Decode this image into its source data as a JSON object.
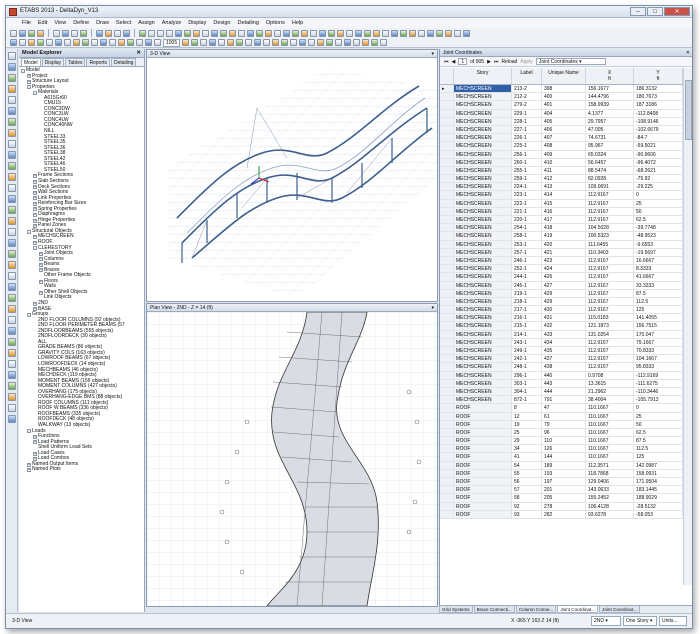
{
  "window": {
    "title": "ETABS 2013 - DeltaDyn_V13",
    "minimize": "–",
    "maximize": "□",
    "close": "✕"
  },
  "menu": [
    "File",
    "Edit",
    "View",
    "Define",
    "Draw",
    "Select",
    "Assign",
    "Analyze",
    "Display",
    "Design",
    "Detailing",
    "Options",
    "Help"
  ],
  "toolbar": {
    "zoom_value": "1005",
    "icons": [
      "new-icon",
      "open-icon",
      "save-icon",
      "undo-icon",
      "redo-icon",
      "lock-icon",
      "run-icon",
      "zoom-in-icon",
      "zoom-out-icon",
      "pan-icon",
      "3d-view-icon",
      "plan-view-icon",
      "elevation-icon",
      "display-icon",
      "select-icon"
    ]
  },
  "explorer": {
    "title": "Model Explorer",
    "close": "✕",
    "tabs": [
      "Model",
      "Display",
      "Tables",
      "Reports",
      "Detailing"
    ],
    "tree": [
      {
        "d": 0,
        "e": "-",
        "t": "Model"
      },
      {
        "d": 1,
        "e": "+",
        "t": "Project"
      },
      {
        "d": 1,
        "e": "+",
        "t": "Structure Layout"
      },
      {
        "d": 1,
        "e": "-",
        "t": "Properties"
      },
      {
        "d": 2,
        "e": "-",
        "t": "Materials"
      },
      {
        "d": 3,
        "e": "",
        "t": "A615Gr60"
      },
      {
        "d": 3,
        "e": "",
        "t": "CMU15"
      },
      {
        "d": 3,
        "e": "",
        "t": "CONC3DW"
      },
      {
        "d": 3,
        "e": "",
        "t": "CONC3LW"
      },
      {
        "d": 3,
        "e": "",
        "t": "CONC4LW"
      },
      {
        "d": 3,
        "e": "",
        "t": "CONC40NW"
      },
      {
        "d": 3,
        "e": "",
        "t": "NILL"
      },
      {
        "d": 3,
        "e": "",
        "t": "STEEL33"
      },
      {
        "d": 3,
        "e": "",
        "t": "STEEL35"
      },
      {
        "d": 3,
        "e": "",
        "t": "STEEL36"
      },
      {
        "d": 3,
        "e": "",
        "t": "STEEL38"
      },
      {
        "d": 3,
        "e": "",
        "t": "STEEL42"
      },
      {
        "d": 3,
        "e": "",
        "t": "STEEL46"
      },
      {
        "d": 3,
        "e": "",
        "t": "STEEL50"
      },
      {
        "d": 2,
        "e": "+",
        "t": "Frame Sections"
      },
      {
        "d": 2,
        "e": "+",
        "t": "Slab Sections"
      },
      {
        "d": 2,
        "e": "+",
        "t": "Deck Sections"
      },
      {
        "d": 2,
        "e": "+",
        "t": "Wall Sections"
      },
      {
        "d": 2,
        "e": "+",
        "t": "Link Properties"
      },
      {
        "d": 2,
        "e": "+",
        "t": "Reinforcing Bar Sizes"
      },
      {
        "d": 2,
        "e": "+",
        "t": "Spring Properties"
      },
      {
        "d": 2,
        "e": "+",
        "t": "Diaphragms"
      },
      {
        "d": 2,
        "e": "+",
        "t": "Hinge Properties"
      },
      {
        "d": 2,
        "e": "+",
        "t": "Panel Zones"
      },
      {
        "d": 1,
        "e": "-",
        "t": "Structural Objects"
      },
      {
        "d": 2,
        "e": "+",
        "t": "MECHSCREEN"
      },
      {
        "d": 2,
        "e": "+",
        "t": "ROOF"
      },
      {
        "d": 2,
        "e": "-",
        "t": "CLERESTORY"
      },
      {
        "d": 3,
        "e": "+",
        "t": "Joint Objects"
      },
      {
        "d": 3,
        "e": "+",
        "t": "Columns"
      },
      {
        "d": 3,
        "e": "+",
        "t": "Beams"
      },
      {
        "d": 3,
        "e": "+",
        "t": "Braces"
      },
      {
        "d": 3,
        "e": "",
        "t": "Other Frame Objects"
      },
      {
        "d": 3,
        "e": "+",
        "t": "Floors"
      },
      {
        "d": 3,
        "e": "",
        "t": "Walls"
      },
      {
        "d": 3,
        "e": "+",
        "t": "Other Shell Objects"
      },
      {
        "d": 3,
        "e": "",
        "t": "Link Objects"
      },
      {
        "d": 2,
        "e": "+",
        "t": "2ND"
      },
      {
        "d": 2,
        "e": "+",
        "t": "BASE"
      },
      {
        "d": 1,
        "e": "-",
        "t": "Groups"
      },
      {
        "d": 2,
        "e": "",
        "t": "2ND FLOOR COLUMNS (92 objects)"
      },
      {
        "d": 2,
        "e": "",
        "t": "2ND FLOOR PERIMETER BEAMS (57"
      },
      {
        "d": 2,
        "e": "",
        "t": "2NDFLOORBEAMS (555 objects)"
      },
      {
        "d": 2,
        "e": "",
        "t": "2NDFLOORDECK (30 objects)"
      },
      {
        "d": 2,
        "e": "",
        "t": "ALL"
      },
      {
        "d": 2,
        "e": "",
        "t": "GRADE BEAMS (86 objects)"
      },
      {
        "d": 2,
        "e": "",
        "t": "GRAVITY COLS (163 objects)"
      },
      {
        "d": 2,
        "e": "",
        "t": "LOWROOF BEAMS (67 objects)"
      },
      {
        "d": 2,
        "e": "",
        "t": "LOWROOFDECK (14 objects)"
      },
      {
        "d": 2,
        "e": "",
        "t": "MECHBEAMS (46 objects)"
      },
      {
        "d": 2,
        "e": "",
        "t": "MECHDECK (119 objects)"
      },
      {
        "d": 2,
        "e": "",
        "t": "MOMENT BEAMS (156 objects)"
      },
      {
        "d": 2,
        "e": "",
        "t": "MOMENT COLUMNS (427 objects)"
      },
      {
        "d": 2,
        "e": "",
        "t": "OVERHANG (175 objects)"
      },
      {
        "d": 2,
        "e": "",
        "t": "OVERHANG-EDGE BMS (88 objects)"
      },
      {
        "d": 2,
        "e": "",
        "t": "ROOF COLUMNS (111 objects)"
      },
      {
        "d": 2,
        "e": "",
        "t": "ROOF W BEAMS (336 objects)"
      },
      {
        "d": 2,
        "e": "",
        "t": "ROOFBEAMS (335 objects)"
      },
      {
        "d": 2,
        "e": "",
        "t": "ROOFDECK (48 objects)"
      },
      {
        "d": 2,
        "e": "",
        "t": "WALKWAY (13 objects)"
      },
      {
        "d": 1,
        "e": "-",
        "t": "Loads"
      },
      {
        "d": 2,
        "e": "+",
        "t": "Functions"
      },
      {
        "d": 2,
        "e": "+",
        "t": "Load Patterns"
      },
      {
        "d": 2,
        "e": "",
        "t": "Shell Uniform Load Sets"
      },
      {
        "d": 2,
        "e": "+",
        "t": "Load Cases"
      },
      {
        "d": 2,
        "e": "+",
        "t": "Load Combos"
      },
      {
        "d": 1,
        "e": "+",
        "t": "Named Output Items"
      },
      {
        "d": 1,
        "e": "+",
        "t": "Named Plots"
      }
    ]
  },
  "view3d": {
    "title": "3-D View"
  },
  "viewplan": {
    "title": "Plan View - 2ND - Z = 14 (ft)"
  },
  "joint": {
    "title": "Joint Coordinates",
    "record": "1",
    "of_text": "of 905",
    "reload": "Reload",
    "apply": "Apply",
    "table_select": "Joint Coordinates",
    "headers": {
      "story": "Story",
      "label": "Label",
      "unique": "Unique Name",
      "x": "X",
      "x_unit": "ft",
      "y": "Y",
      "y_unit": "ft"
    },
    "rows": [
      [
        "MECHSCREEN",
        "213-2",
        "398",
        "156.1677",
        "186.3132"
      ],
      [
        "MECHSCREEN",
        "212-2",
        "400",
        "144.4796",
        "180.7673"
      ],
      [
        "MECHSCREEN",
        "279-2",
        "401",
        "158.9939",
        "187.3186"
      ],
      [
        "MECHSCREEN",
        "229-1",
        "404",
        "4.1377",
        "-112.8408"
      ],
      [
        "MECHSCREEN",
        "228-1",
        "405",
        "29.7957",
        "-108.9146"
      ],
      [
        "MECHSCREEN",
        "227-1",
        "406",
        "47.005",
        "-102.6679"
      ],
      [
        "MECHSCREEN",
        "226-1",
        "407",
        "74.6731",
        "-84.7"
      ],
      [
        "MECHSCREEN",
        "225-1",
        "408",
        "95.967",
        "-59.5021"
      ],
      [
        "MECHSCREEN",
        "256-1",
        "409",
        "65.0324",
        "-90.9606"
      ],
      [
        "MECHSCREEN",
        "260-1",
        "410",
        "56.6457",
        "-96.4072"
      ],
      [
        "MECHSCREEN",
        "255-1",
        "411",
        "88.5474",
        "-68.2621"
      ],
      [
        "MECHSCREEN",
        "259-1",
        "412",
        "82.0928",
        "-75.92"
      ],
      [
        "MECHSCREEN",
        "224-1",
        "413",
        "109.0691",
        "-29.225"
      ],
      [
        "MECHSCREEN",
        "223-1",
        "414",
        "112.9167",
        "0"
      ],
      [
        "MECHSCREEN",
        "222-1",
        "415",
        "112.9167",
        "25"
      ],
      [
        "MECHSCREEN",
        "221-1",
        "416",
        "112.9167",
        "50"
      ],
      [
        "MECHSCREEN",
        "220-1",
        "417",
        "112.9167",
        "62.5"
      ],
      [
        "MECHSCREEN",
        "254-1",
        "418",
        "104.5028",
        "-39.7748"
      ],
      [
        "MECHSCREEN",
        "258-1",
        "419",
        "100.5323",
        "-48.9523"
      ],
      [
        "MECHSCREEN",
        "253-1",
        "420",
        "111.6455",
        "-9.6553"
      ],
      [
        "MECHSCREEN",
        "257-1",
        "421",
        "110.3403",
        "-19.5697"
      ],
      [
        "MECHSCREEN",
        "246-1",
        "423",
        "112.9167",
        "16.6667"
      ],
      [
        "MECHSCREEN",
        "252-1",
        "424",
        "112.9167",
        "8.3333"
      ],
      [
        "MECHSCREEN",
        "244-1",
        "426",
        "112.9167",
        "41.6667"
      ],
      [
        "MECHSCREEN",
        "245-1",
        "427",
        "112.9167",
        "33.3333"
      ],
      [
        "MECHSCREEN",
        "219-1",
        "429",
        "112.9167",
        "87.5"
      ],
      [
        "MECHSCREEN",
        "218-1",
        "429",
        "112.9167",
        "112.5"
      ],
      [
        "MECHSCREEN",
        "217-1",
        "430",
        "112.9167",
        "125"
      ],
      [
        "MECHSCREEN",
        "216-1",
        "431",
        "115.0183",
        "141.4055"
      ],
      [
        "MECHSCREEN",
        "215-1",
        "432",
        "121.1873",
        "156.7515"
      ],
      [
        "MECHSCREEN",
        "214-1",
        "433",
        "131.0254",
        "170.047"
      ],
      [
        "MECHSCREEN",
        "243-1",
        "434",
        "112.9167",
        "79.1667"
      ],
      [
        "MECHSCREEN",
        "249-1",
        "435",
        "112.9167",
        "70.8333"
      ],
      [
        "MECHSCREEN",
        "242-1",
        "437",
        "112.9167",
        "104.1667"
      ],
      [
        "MECHSCREEN",
        "248-1",
        "438",
        "112.9167",
        "95.8333"
      ],
      [
        "MECHSCREEN",
        "296-1",
        "440",
        "0.9708",
        "-112.9169"
      ],
      [
        "MECHSCREEN",
        "303-1",
        "443",
        "13.3615",
        "-111.6275"
      ],
      [
        "MECHSCREEN",
        "304-1",
        "444",
        "21.2962",
        "-110.3446"
      ],
      [
        "MECHSCREEN",
        "872-1",
        "791",
        "38.4004",
        "-105.7913"
      ],
      [
        "ROOF",
        "8",
        "47",
        "110.1667",
        "0"
      ],
      [
        "ROOF",
        "12",
        "61",
        "110.1667",
        "25"
      ],
      [
        "ROOF",
        "19",
        "79",
        "110.1667",
        "50"
      ],
      [
        "ROOF",
        "25",
        "96",
        "110.1667",
        "62.5"
      ],
      [
        "ROOF",
        "29",
        "110",
        "110.1667",
        "87.5"
      ],
      [
        "ROOF",
        "34",
        "126",
        "110.1667",
        "112.5"
      ],
      [
        "ROOF",
        "41",
        "144",
        "110.1667",
        "125"
      ],
      [
        "ROOF",
        "54",
        "189",
        "112.3571",
        "142.0987"
      ],
      [
        "ROOF",
        "55",
        "193",
        "118.7868",
        "158.0931"
      ],
      [
        "ROOF",
        "56",
        "197",
        "129.0406",
        "171.9504"
      ],
      [
        "ROOF",
        "57",
        "201",
        "143.0633",
        "183.1445"
      ],
      [
        "ROOF",
        "58",
        "205",
        "155.2452",
        "188.9029"
      ],
      [
        "ROOF",
        "92",
        "278",
        "106.4128",
        "-28.5132"
      ],
      [
        "ROOF",
        "93",
        "282",
        "93.6278",
        "-58.053"
      ]
    ]
  },
  "bottom_tabs": [
    "Grid Systems",
    "Brace Connecti...",
    "Column Conne...",
    "Joint Coordinat...",
    "Joint Coordinat..."
  ],
  "status": {
    "left": "3-D View",
    "coords": "X -365  Y 163  Z 14 (ft)",
    "story": "2ND",
    "story_mode": "One Story",
    "units": "Units..."
  }
}
